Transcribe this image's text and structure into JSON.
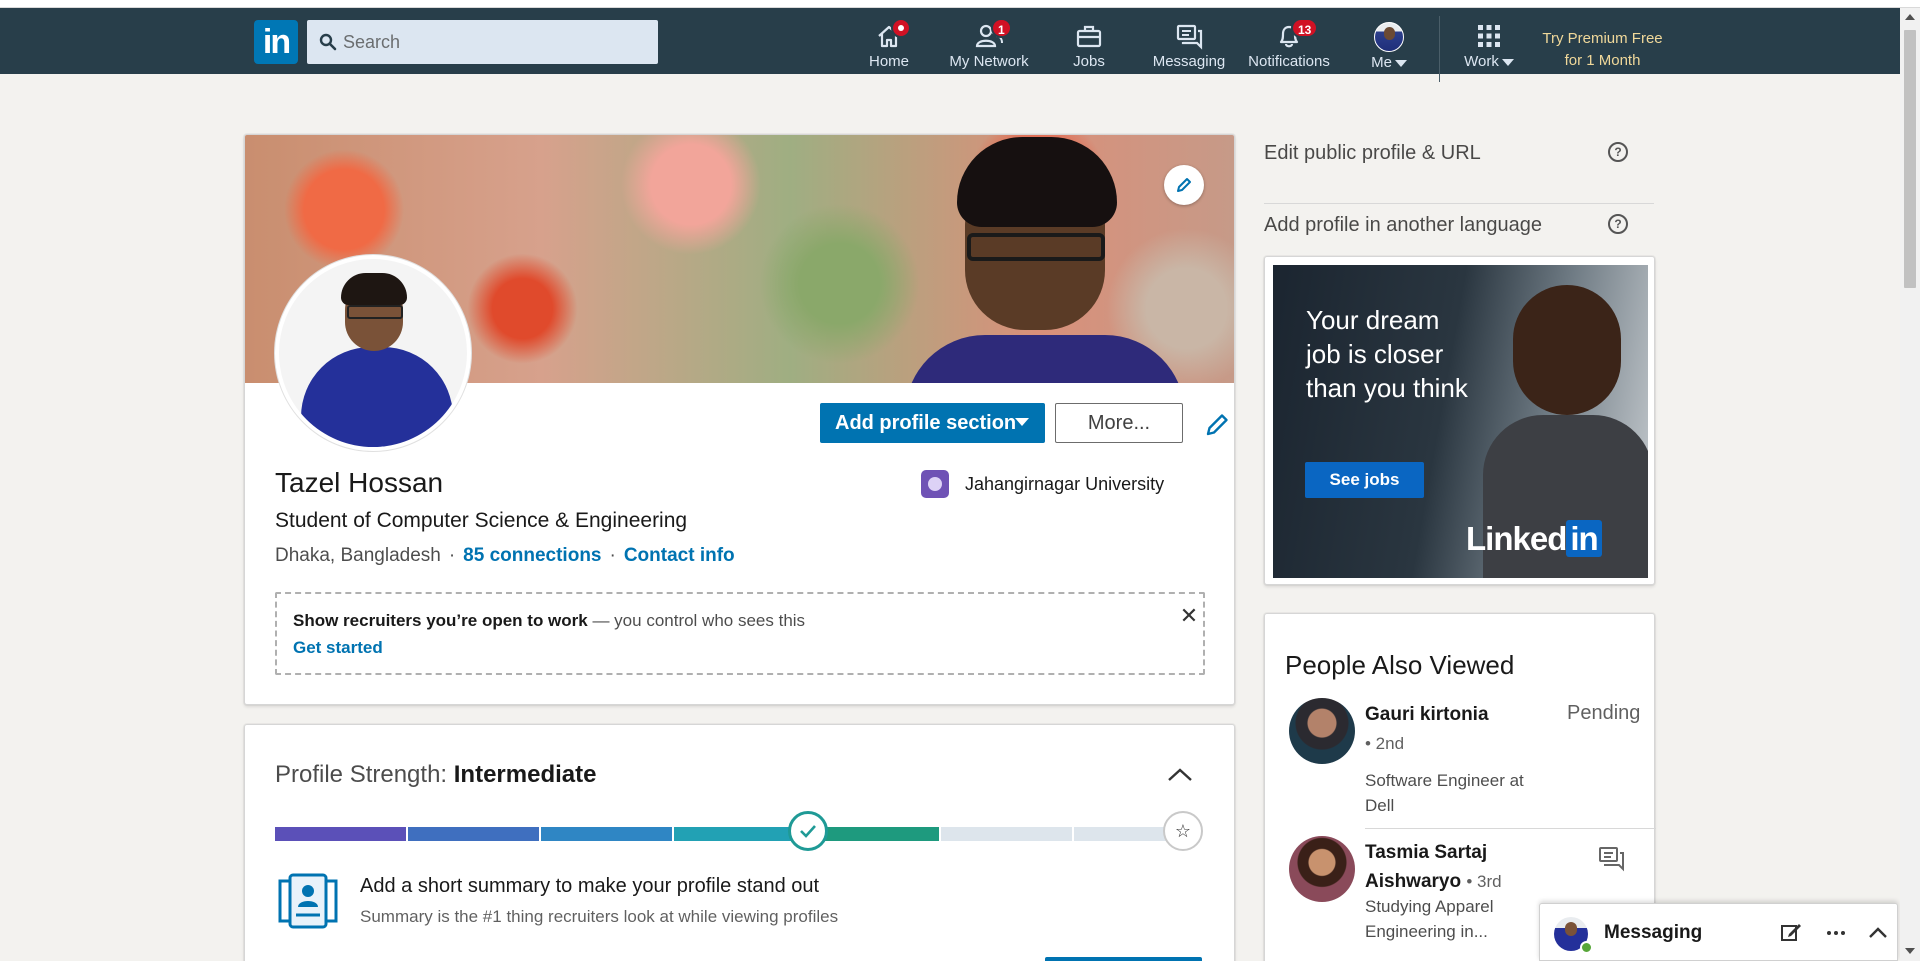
{
  "nav": {
    "logo_text": "in",
    "search_placeholder": "Search",
    "items": [
      {
        "label": "Home",
        "badge": "",
        "icon": "home-icon"
      },
      {
        "label": "My Network",
        "badge": "1",
        "icon": "network-icon"
      },
      {
        "label": "Jobs",
        "badge": "",
        "icon": "briefcase-icon"
      },
      {
        "label": "Messaging",
        "badge": "",
        "icon": "messaging-icon"
      },
      {
        "label": "Notifications",
        "badge": "13",
        "icon": "bell-icon"
      },
      {
        "label": "Me",
        "badge": "",
        "icon": "avatar"
      },
      {
        "label": "Work",
        "badge": "",
        "icon": "grid-icon"
      }
    ],
    "premium_line1": "Try Premium Free",
    "premium_line2": "for 1 Month"
  },
  "profile": {
    "name": "Tazel Hossan",
    "headline": "Student of Computer Science & Engineering",
    "location": "Dhaka, Bangladesh",
    "connections": "85 connections",
    "contact": "Contact info",
    "education": "Jahangirnagar University",
    "add_section_label": "Add profile section",
    "more_label": "More...",
    "open_to_work": {
      "bold": "Show recruiters you’re open to work",
      "rest": " — you control who sees this",
      "link": "Get started"
    }
  },
  "strength": {
    "prefix": "Profile Strength: ",
    "level": "Intermediate",
    "progress_fraction": 0.6,
    "tip_title": "Add a short summary to make your profile stand out",
    "tip_sub": "Summary is the #1 thing recruiters look at while viewing profiles"
  },
  "rail": {
    "edit_public": "Edit public profile & URL",
    "add_language": "Add profile in another language",
    "help_glyph": "?",
    "ad": {
      "headline": "Your dream job is closer than you think",
      "button": "See jobs",
      "logo_word": "Linked",
      "logo_in": "in"
    },
    "people_title": "People Also Viewed",
    "people": [
      {
        "name": "Gauri kirtonia",
        "degree": "• 2nd",
        "headline": "Software Engineer at Dell",
        "action": "Pending"
      },
      {
        "name": "Tasmia Sartaj Aishwaryo",
        "degree": "• 3rd",
        "headline": "Studying Apparel Engineering in...",
        "action": ""
      }
    ]
  },
  "messaging": {
    "label": "Messaging"
  },
  "colors": {
    "nav_bg": "#283e4a",
    "brand_blue": "#0073b1",
    "badge_red": "#d11124",
    "premium_gold": "#f0d89a"
  }
}
